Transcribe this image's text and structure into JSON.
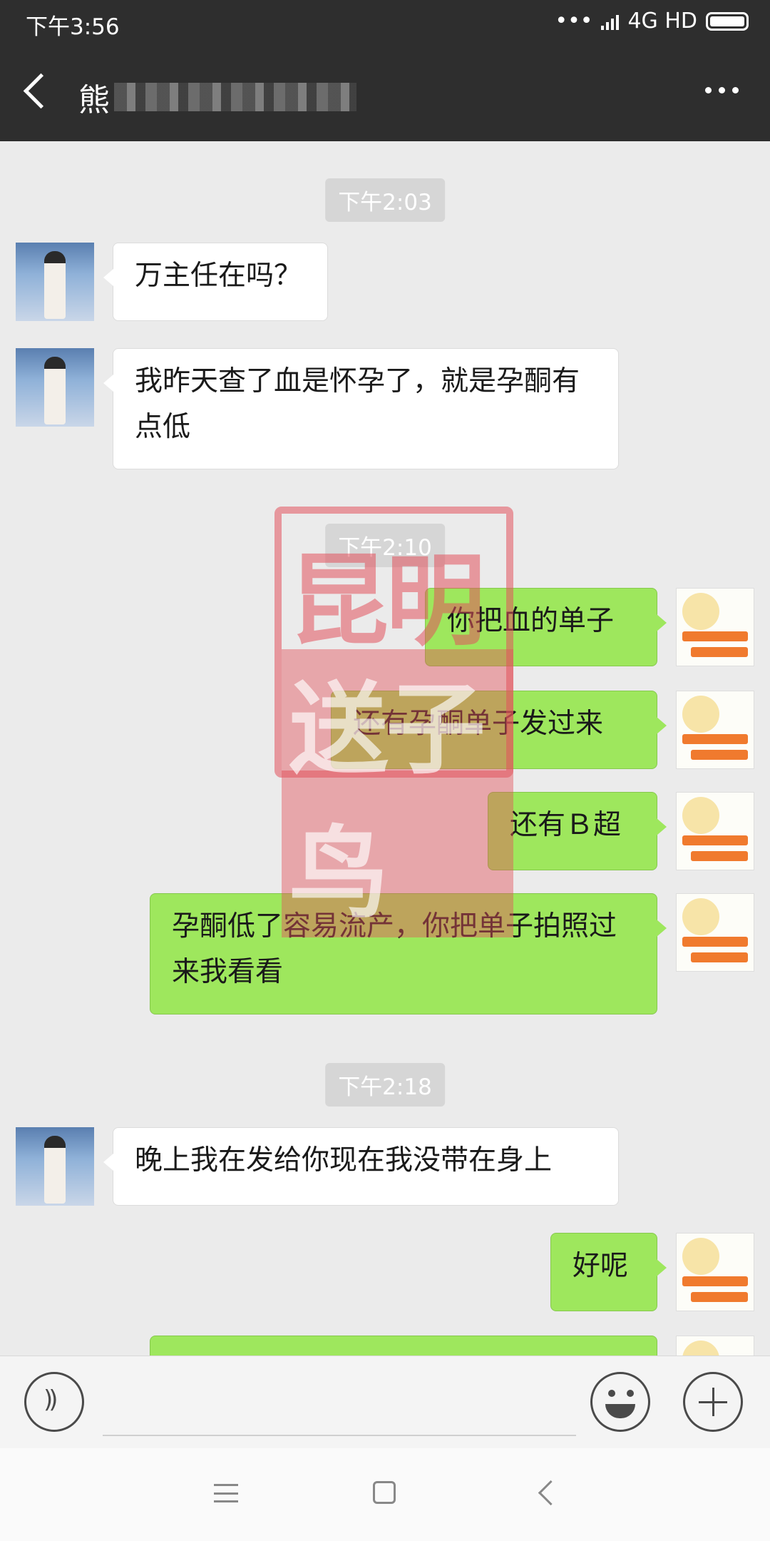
{
  "status_bar": {
    "time": "下午3:56",
    "network": "4G HD"
  },
  "header": {
    "title": "熊"
  },
  "messages": [
    {
      "kind": "time",
      "text": "下午2:03"
    },
    {
      "kind": "in",
      "text": "万主任在吗？"
    },
    {
      "kind": "in",
      "text": "我昨天查了血是怀孕了，就是孕酮有点低"
    },
    {
      "kind": "time",
      "text": "下午2:10"
    },
    {
      "kind": "out",
      "text": "你把血的单子"
    },
    {
      "kind": "out",
      "text": "还有孕酮单子发过来"
    },
    {
      "kind": "out",
      "text": "还有Ｂ超"
    },
    {
      "kind": "out",
      "text": "孕酮低了容易流产，你把单子拍照过来我看看"
    },
    {
      "kind": "time",
      "text": "下午2:18"
    },
    {
      "kind": "in",
      "text": "晚上我在发给你现在我没带在身上"
    },
    {
      "kind": "out",
      "text": "好呢"
    }
  ],
  "watermark": {
    "line1": "昆明",
    "line2": "送子鸟"
  },
  "input": {
    "value": ""
  },
  "colors": {
    "header_bg": "#2e2e2e",
    "chat_bg": "#ebebeb",
    "outgoing_bubble": "#9ee75d",
    "incoming_bubble": "#ffffff"
  }
}
